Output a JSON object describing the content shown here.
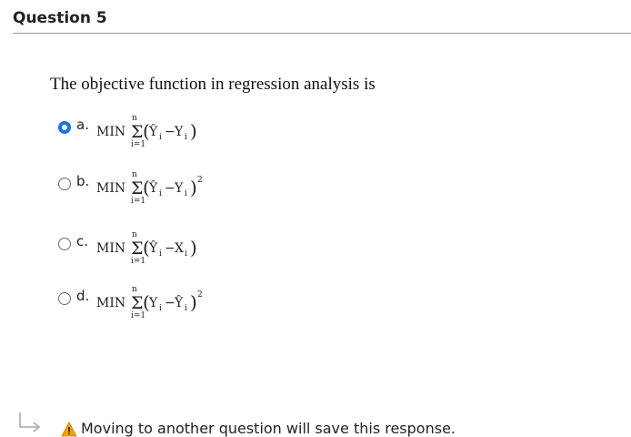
{
  "question": {
    "title": "Question 5",
    "text": "The objective function in regression analysis is"
  },
  "options": [
    {
      "letter": "a.",
      "min": "MIN",
      "top": "n",
      "bottom": "i=1",
      "term1": "Ŷ",
      "sub1": "i",
      "minus": "−",
      "term2": "Y",
      "sub2": "i",
      "power": "",
      "selected": true
    },
    {
      "letter": "b.",
      "min": "MIN",
      "top": "n",
      "bottom": "i=1",
      "term1": "Ŷ",
      "sub1": "i",
      "minus": "−",
      "term2": "Y",
      "sub2": "i",
      "power": "2",
      "selected": false
    },
    {
      "letter": "c.",
      "min": "MIN",
      "top": "n",
      "bottom": "i=1",
      "term1": "Ŷ",
      "sub1": "i",
      "minus": "−",
      "term2": "X",
      "sub2": "i",
      "power": "",
      "selected": false
    },
    {
      "letter": "d.",
      "min": "MIN",
      "top": "n",
      "bottom": "i=1",
      "term1": "Y",
      "sub1": "i",
      "minus": "−",
      "term2": "Ŷ",
      "sub2": "i",
      "power": "2",
      "selected": false
    }
  ],
  "footer": {
    "warning_text": "Moving to another question will save this response.",
    "arrow_icon": "return-arrow-icon",
    "warning_icon": "warning-icon"
  },
  "colors": {
    "radio_selected": "#1a73e8",
    "warning": "#f0a30a"
  }
}
